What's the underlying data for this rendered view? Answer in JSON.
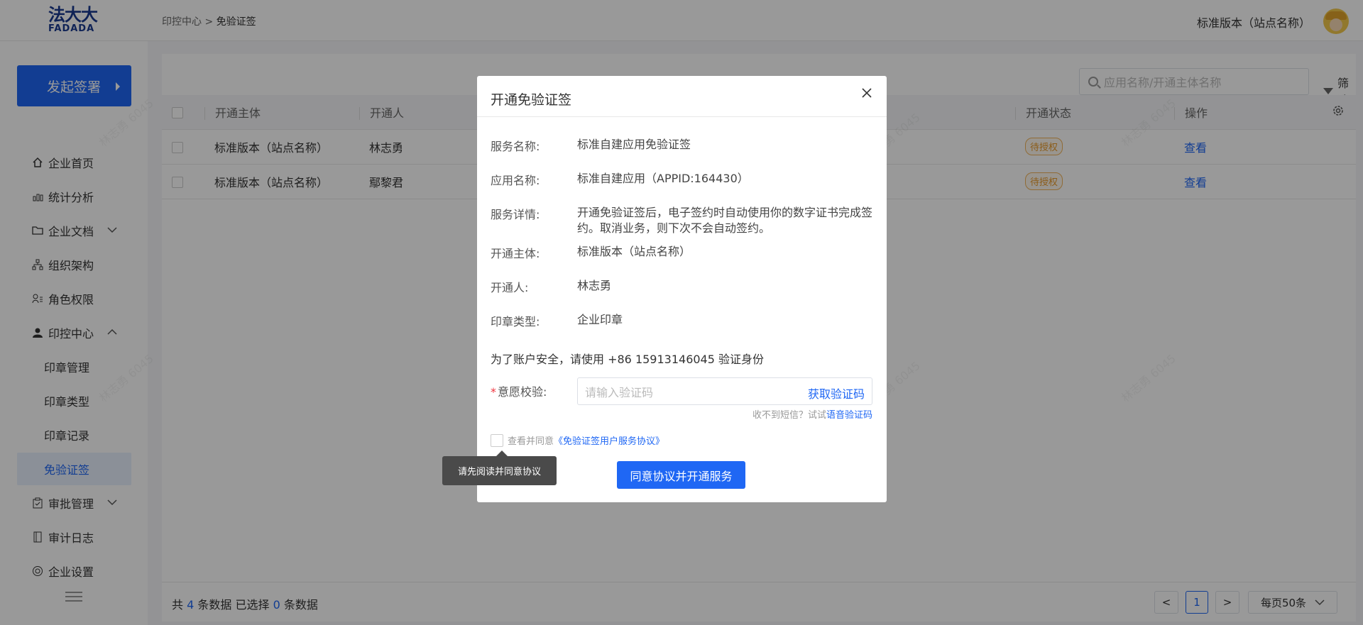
{
  "header": {
    "logo_cn": "法大大",
    "logo_en": "FADADA",
    "breadcrumb_parent": "印控中心",
    "breadcrumb_sep": ">",
    "breadcrumb_current": "免验证签",
    "site_name": "标准版本（站点名称）"
  },
  "sidebar": {
    "start_button": "发起签署",
    "items": [
      {
        "label": "企业首页",
        "icon": "home-icon"
      },
      {
        "label": "统计分析",
        "icon": "bar-chart-icon"
      },
      {
        "label": "企业文档",
        "icon": "folder-icon"
      },
      {
        "label": "组织架构",
        "icon": "org-tree-icon"
      },
      {
        "label": "角色权限",
        "icon": "user-role-icon"
      },
      {
        "label": "印控中心",
        "icon": "person-icon"
      },
      {
        "label": "审批管理",
        "icon": "clipboard-icon"
      },
      {
        "label": "审计日志",
        "icon": "book-icon"
      },
      {
        "label": "企业设置",
        "icon": "gear-icon"
      }
    ],
    "sub_items": [
      "印章管理",
      "印章类型",
      "印章记录",
      "免验证签"
    ]
  },
  "main": {
    "search_placeholder": "应用名称/开通主体名称",
    "filter_label": "筛选",
    "columns": {
      "subject": "开通主体",
      "operator": "开通人",
      "status": "开通状态",
      "action": "操作"
    },
    "rows": [
      {
        "subject": "标准版本（站点名称）",
        "operator": "林志勇",
        "status": "待授权",
        "action": "查看"
      },
      {
        "subject": "标准版本（站点名称）",
        "operator": "鄢黎君",
        "status": "待授权",
        "action": "查看"
      }
    ],
    "footer": {
      "prefix": "共",
      "total": "4",
      "mid": "条数据  已选择",
      "selected": "0",
      "suffix": "条数据"
    },
    "pagination": {
      "prev": "<",
      "page": "1",
      "next": ">",
      "page_size": "每页50条"
    },
    "watermark": "林志勇 6045"
  },
  "modal": {
    "title": "开通免验证签",
    "close": "X",
    "fields": [
      {
        "label": "服务名称:",
        "value": "标准自建应用免验证签"
      },
      {
        "label": "应用名称:",
        "value": "标准自建应用（APPID:164430）"
      },
      {
        "label": "服务详情:",
        "value": "开通免验证签后，电子签约时自动使用你的数字证书完成签约。取消业务，则下次不会自动签约。"
      },
      {
        "label": "开通主体:",
        "value": "标准版本（站点名称）"
      },
      {
        "label": "开通人:",
        "value": "林志勇"
      },
      {
        "label": "印章类型:",
        "value": "企业印章"
      }
    ],
    "notice": "为了账户安全，请使用 +86 15913146045 验证身份",
    "verify_required": "*",
    "verify_label": "意愿校验:",
    "verify_placeholder": "请输入验证码",
    "get_code": "获取验证码",
    "hint_prefix": "收不到短信？试试",
    "hint_link": "语音验证码",
    "agree_prefix": "查看并同意",
    "agree_link": "《免验证签用户服务协议》",
    "submit": "同意协议并开通服务",
    "tooltip": "请先阅读并同意协议"
  }
}
